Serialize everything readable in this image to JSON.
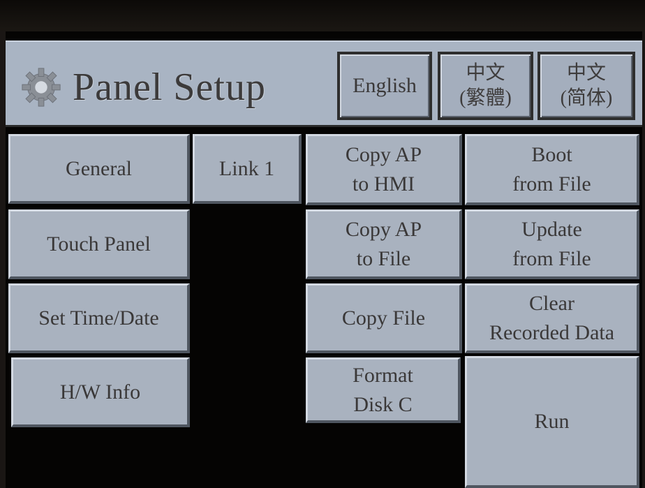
{
  "header": {
    "title": "Panel Setup",
    "icon": "gear-icon",
    "languages": [
      {
        "label": "English"
      },
      {
        "label": "中文\n(繁體)"
      },
      {
        "label": "中文\n(简体)"
      }
    ]
  },
  "menu": {
    "general": "General",
    "link1": "Link 1",
    "copy_ap_to_hmi": "Copy AP\nto HMI",
    "boot_from_file": "Boot\nfrom File",
    "touch_panel": "Touch Panel",
    "copy_ap_to_file": "Copy AP\nto File",
    "update_from_file": "Update\nfrom File",
    "set_time_date": "Set Time/Date",
    "copy_file": "Copy File",
    "clear_recorded_data": "Clear\nRecorded Data",
    "hw_info": "H/W Info",
    "format_disk_c": "Format\nDisk C",
    "run": "Run"
  },
  "colors": {
    "panel_bg": "#a9b4c3",
    "button_face": "#a9b2bf",
    "text": "#3a3838",
    "background": "#050403"
  }
}
